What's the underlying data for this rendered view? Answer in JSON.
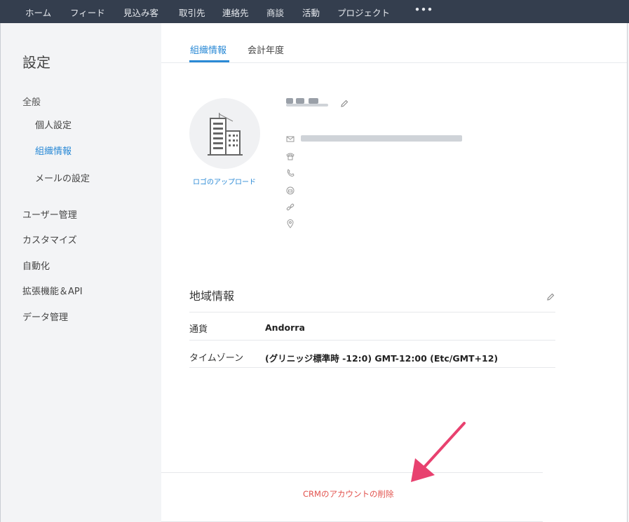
{
  "topnav": {
    "items": [
      "ホーム",
      "フィード",
      "見込み客",
      "取引先",
      "連絡先",
      "商談",
      "活動",
      "プロジェクト"
    ],
    "more": "•••"
  },
  "sidebar": {
    "title": "設定",
    "general_heading": "全般",
    "sub_items": [
      "個人設定",
      "組織情報",
      "メールの設定"
    ],
    "active_sub": "組織情報",
    "items": [
      "ユーザー管理",
      "カスタマイズ",
      "自動化",
      "拡張機能＆API",
      "データ管理"
    ]
  },
  "tabs": [
    "組織情報",
    "会計年度"
  ],
  "org": {
    "upload_logo": "ロゴのアップロード",
    "icons": [
      "mail-icon",
      "phone-icon",
      "mobile-icon",
      "fax-icon",
      "link-icon",
      "location-icon"
    ]
  },
  "locale": {
    "title": "地域情報",
    "rows": [
      {
        "label": "通貨",
        "value": "Andorra"
      },
      {
        "label": "タイムゾーン",
        "value": "(グリニッジ標準時 -12:0) GMT-12:00 (Etc/GMT+12)"
      }
    ]
  },
  "footer": {
    "delete_account": "CRMのアカウントの削除"
  },
  "colors": {
    "topbar": "#343e4e",
    "accent": "#2b8ad6",
    "danger": "#e2524d",
    "arrow": "#e8416f"
  }
}
